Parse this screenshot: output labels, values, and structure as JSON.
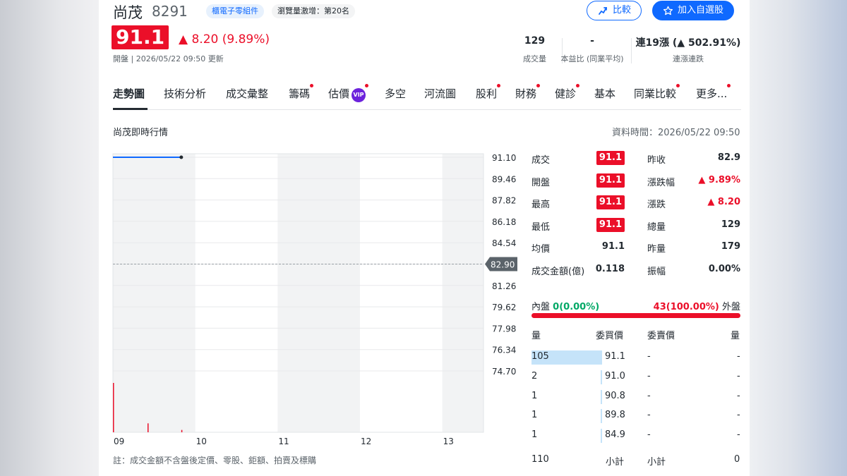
{
  "header": {
    "name": "尚茂",
    "code": "8291",
    "industry_tag": "櫃電子零組件",
    "rank_tag": "瀏覽量激增：第20名",
    "compare_label": "比較",
    "add_label": "加入自選股"
  },
  "price": {
    "value": "91.1",
    "change": "▲ 8.20 (9.89%)",
    "open_time": "開盤 | 2026/05/22 09:50 更新"
  },
  "stats": [
    {
      "value": "129",
      "label": "成交量"
    },
    {
      "value": "-",
      "label": "本益比 (同業平均)"
    },
    {
      "value": "連19漲 (▲ 502.91%)",
      "label": "連漲連跌"
    }
  ],
  "tabs": [
    {
      "label": "走勢圖",
      "active": true,
      "dot": false
    },
    {
      "label": "技術分析",
      "active": false,
      "dot": false
    },
    {
      "label": "成交彙整",
      "active": false,
      "dot": false
    },
    {
      "label": "籌碼",
      "active": false,
      "dot": true
    },
    {
      "label": "估價",
      "active": false,
      "dot": true,
      "vip": "VIP"
    },
    {
      "label": "多空",
      "active": false,
      "dot": false
    },
    {
      "label": "河流圖",
      "active": false,
      "dot": false
    },
    {
      "label": "股利",
      "active": false,
      "dot": true
    },
    {
      "label": "財務",
      "active": false,
      "dot": true
    },
    {
      "label": "健診",
      "active": false,
      "dot": true
    },
    {
      "label": "基本",
      "active": false,
      "dot": false
    },
    {
      "label": "同業比較",
      "active": false,
      "dot": true
    },
    {
      "label": "更多...",
      "active": false,
      "dot": true
    }
  ],
  "section": {
    "title": "尚茂即時行情",
    "data_time": "資料時間：2026/05/22 09:50"
  },
  "chart_data": {
    "type": "line",
    "title": "",
    "xlabel": "",
    "ylabel": "",
    "x_ticks": [
      "09",
      "10",
      "11",
      "12",
      "13"
    ],
    "y_ticks": [
      "91.10",
      "89.46",
      "87.82",
      "86.18",
      "84.54",
      "82.90",
      "81.26",
      "79.62",
      "77.98",
      "76.34",
      "74.70"
    ],
    "ylim": [
      74.7,
      91.1
    ],
    "xlim_hours": [
      9,
      13.5
    ],
    "reference_price": 82.9,
    "reference_label": "82.90",
    "series": [
      {
        "x_hours": [
          9.0,
          9.83
        ],
        "values": [
          91.1,
          91.1
        ]
      }
    ],
    "volume": {
      "x_hours": [
        9.0,
        9.42,
        9.83
      ],
      "values": [
        105,
        19,
        5
      ]
    },
    "color_up": "#eb0f29",
    "color_line": "#0f69ff",
    "grid": true
  },
  "quote": {
    "rows": [
      {
        "l1": "成交",
        "v1": "91.1",
        "box1": true,
        "l2": "昨收",
        "v2": "82.9",
        "up2": false
      },
      {
        "l1": "開盤",
        "v1": "91.1",
        "box1": true,
        "l2": "漲跌幅",
        "v2": "▲ 9.89%",
        "up2": true
      },
      {
        "l1": "最高",
        "v1": "91.1",
        "box1": true,
        "l2": "漲跌",
        "v2": "▲ 8.20",
        "up2": true
      },
      {
        "l1": "最低",
        "v1": "91.1",
        "box1": true,
        "l2": "總量",
        "v2": "129",
        "up2": false
      },
      {
        "l1": "均價",
        "v1": "91.1",
        "box1": false,
        "l2": "昨量",
        "v2": "179",
        "up2": false
      },
      {
        "l1": "成交金額(億)",
        "v1": "0.118",
        "box1": false,
        "l2": "振幅",
        "v2": "0.00%",
        "up2": false
      }
    ]
  },
  "inout": {
    "inner_label": "內盤",
    "inner_value": "0(0.00%)",
    "outer_value": "43(100.00%)",
    "outer_label": "外盤"
  },
  "orderbook": {
    "headers": [
      "量",
      "委買價",
      "委賣價",
      "量"
    ],
    "rows": [
      {
        "bid_qty": "105",
        "bid_price": "91.1",
        "ask_price": "-",
        "ask_qty": "-",
        "bid_ratio": 1.0
      },
      {
        "bid_qty": "2",
        "bid_price": "91.0",
        "ask_price": "-",
        "ask_qty": "-",
        "bid_ratio": 0.02
      },
      {
        "bid_qty": "1",
        "bid_price": "90.8",
        "ask_price": "-",
        "ask_qty": "-",
        "bid_ratio": 0.01
      },
      {
        "bid_qty": "1",
        "bid_price": "89.8",
        "ask_price": "-",
        "ask_qty": "-",
        "bid_ratio": 0.01
      },
      {
        "bid_qty": "1",
        "bid_price": "84.9",
        "ask_price": "-",
        "ask_qty": "-",
        "bid_ratio": 0.01
      }
    ],
    "footer": {
      "bid_total": "110",
      "bid_label": "小計",
      "ask_label": "小計",
      "ask_total": "0"
    }
  },
  "footnote": "註：成交金額不含盤後定價、零股、鉅額、拍賣及標購"
}
